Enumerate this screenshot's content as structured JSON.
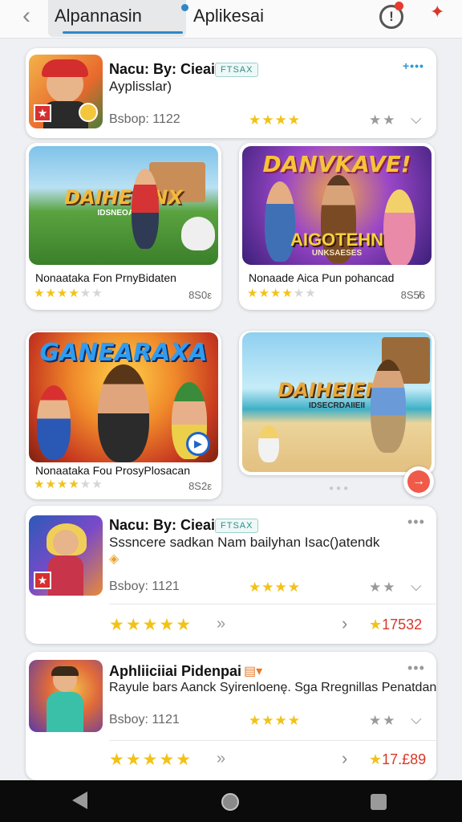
{
  "header": {
    "back_icon": "chevron-left-icon",
    "tab_active": "Alpannasin",
    "tab_inactive": "Aplikesai",
    "alert_glyph": "!",
    "accent": "#2f87c8"
  },
  "cards": [
    {
      "title": "Nacu: By: Cieai",
      "badge": "FTSAX",
      "subtitle": "Ayplisslar)",
      "meta": "Bsbop: 1122",
      "stars": "★★★★",
      "more": "+•••"
    },
    {
      "title": "Nacu: By: Cieai",
      "badge": "FTSAX",
      "subtitle": "Sssncere sadkan Nam bailyhan Isac()atendk",
      "meta": "Bsboy: 1121",
      "stars": "★★★★",
      "big_stars": "★★★★★",
      "price": "17532"
    },
    {
      "title": "Aphliiciiai Pidenpai",
      "subtitle": "Rayule bars Aanck Syirenloenę. Sga Rregnillas Penatdan",
      "meta": "Bsboy: 1121",
      "stars": "★★★★",
      "big_stars": "★★★★★",
      "price": "17.£89"
    }
  ],
  "tiles": [
    {
      "banner": "DAIHEIENX",
      "subbanner": "IDSNEOAIIED",
      "name": "Nonaataka Fon PrnyBidaten",
      "count": "8S0ε",
      "rating": 3.5
    },
    {
      "banner": "DANVKAVE!",
      "subbanner": "AIGOTEHN",
      "subbanner2": "UNKSAESES",
      "name": "Nonaade Aica Pun pohancad",
      "count": "8S5̸6",
      "rating": 3.5
    },
    {
      "banner": "GANEARAXA",
      "subbanner": "",
      "name": "Nonaataka Fou ProsyPlosacan",
      "count": "8S2ε",
      "rating": 3.5
    },
    {
      "banner": "DAIHEIENX",
      "subbanner": "IDSECRDAIIEII",
      "name": "",
      "count": "",
      "rating": 0
    }
  ],
  "pager": "●●●"
}
